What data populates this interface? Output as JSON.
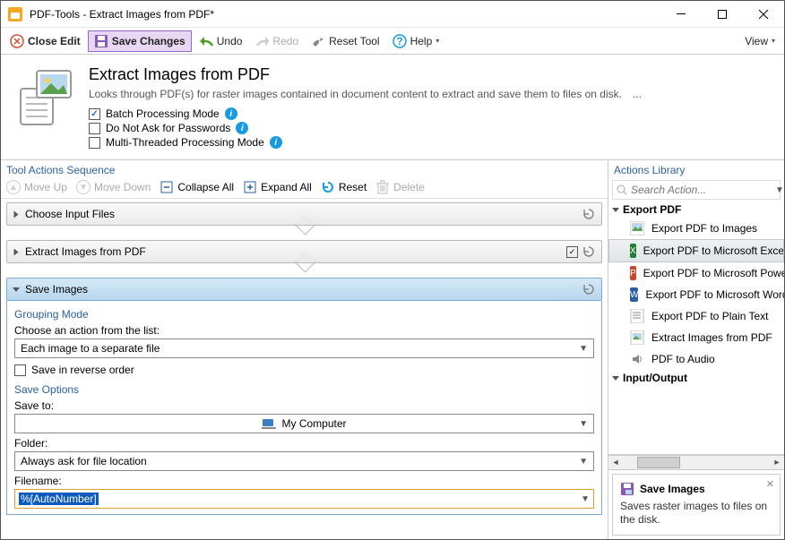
{
  "window": {
    "title": "PDF-Tools - Extract Images from PDF*"
  },
  "toolbar": {
    "close_edit": "Close Edit",
    "save_changes": "Save Changes",
    "undo": "Undo",
    "redo": "Redo",
    "reset_tool": "Reset Tool",
    "help": "Help",
    "view": "View"
  },
  "header": {
    "title": "Extract Images from PDF",
    "description": "Looks through PDF(s) for raster images contained in document content to extract and save them to files on disk.",
    "more": "...",
    "batch_label": "Batch Processing Mode",
    "nopw_label": "Do Not Ask for Passwords",
    "multi_label": "Multi-Threaded Processing Mode"
  },
  "sequence": {
    "title": "Tool Actions Sequence",
    "move_up": "Move Up",
    "move_down": "Move Down",
    "collapse_all": "Collapse All",
    "expand_all": "Expand All",
    "reset": "Reset",
    "delete": "Delete",
    "sec1": "Choose Input Files",
    "sec2": "Extract Images from PDF",
    "sec3": "Save Images"
  },
  "save_images": {
    "grouping_title": "Grouping Mode",
    "choose_action": "Choose an action from the list:",
    "grouping_value": "Each image to a separate file",
    "reverse_label": "Save in reverse order",
    "save_options_title": "Save Options",
    "save_to_label": "Save to:",
    "save_to_value": "My Computer",
    "folder_label": "Folder:",
    "folder_value": "Always ask for file location",
    "filename_label": "Filename:",
    "filename_value": "%[AutoNumber]"
  },
  "library": {
    "title": "Actions Library",
    "search_placeholder": "Search Action...",
    "group1": "Export PDF",
    "items": [
      "Export PDF to Images",
      "Export PDF to Microsoft Excel Spreadsheet",
      "Export PDF to Microsoft PowerPoint",
      "Export PDF to Microsoft Word",
      "Export PDF to Plain Text",
      "Extract Images from PDF",
      "PDF to Audio"
    ],
    "group2": "Input/Output"
  },
  "info": {
    "title": "Save Images",
    "desc": "Saves raster images to files on the disk."
  }
}
